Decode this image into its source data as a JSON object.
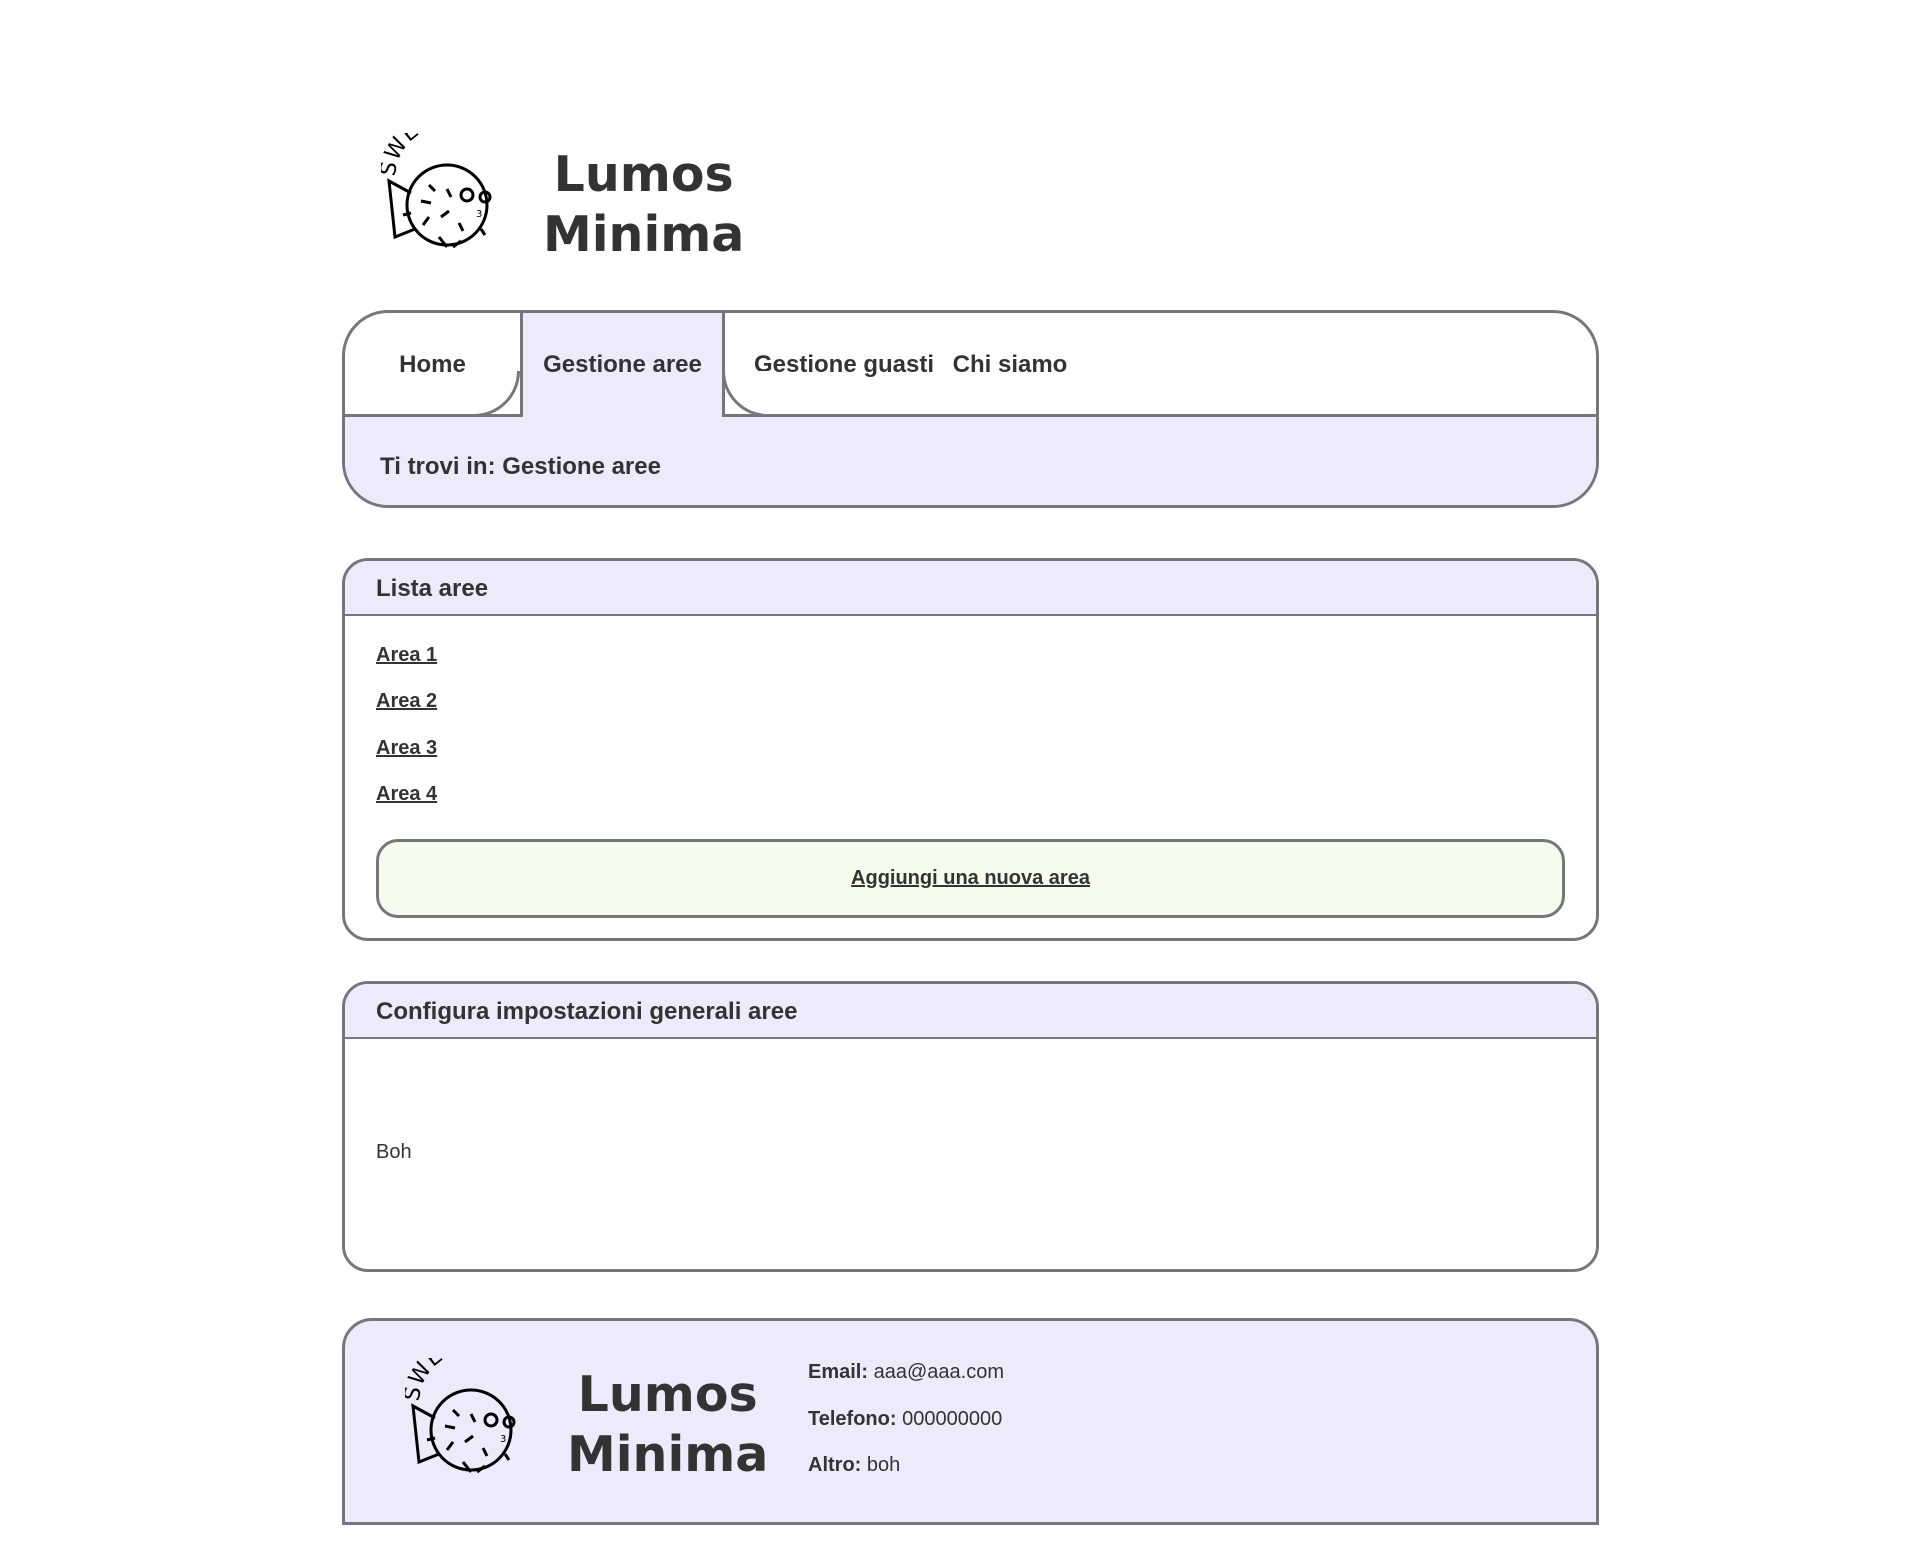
{
  "brand": {
    "line1": "Lumos",
    "line2": "Minima",
    "logo_text": "SWEFISH"
  },
  "nav": {
    "tabs": [
      {
        "label": "Home"
      },
      {
        "label": "Gestione aree"
      },
      {
        "label": "Gestione guasti"
      },
      {
        "label": "Chi siamo"
      }
    ],
    "active_tab": "Gestione aree",
    "breadcrumb": "Ti trovi in: Gestione aree"
  },
  "lista_aree": {
    "title": "Lista aree",
    "items": [
      "Area 1",
      "Area 2",
      "Area 3",
      "Area 4"
    ],
    "add_button": "Aggiungi una nuova area"
  },
  "config": {
    "title": "Configura impostazioni generali aree",
    "body": "Boh"
  },
  "footer": {
    "email_label": "Email:",
    "email": "aaa@aaa.com",
    "phone_label": "Telefono:",
    "phone": "000000000",
    "other_label": "Altro:",
    "other": "boh"
  },
  "colors": {
    "accent_bg": "#ebebfc",
    "button_bg": "#f5fced",
    "border": "#77767c",
    "text": "#333333"
  }
}
